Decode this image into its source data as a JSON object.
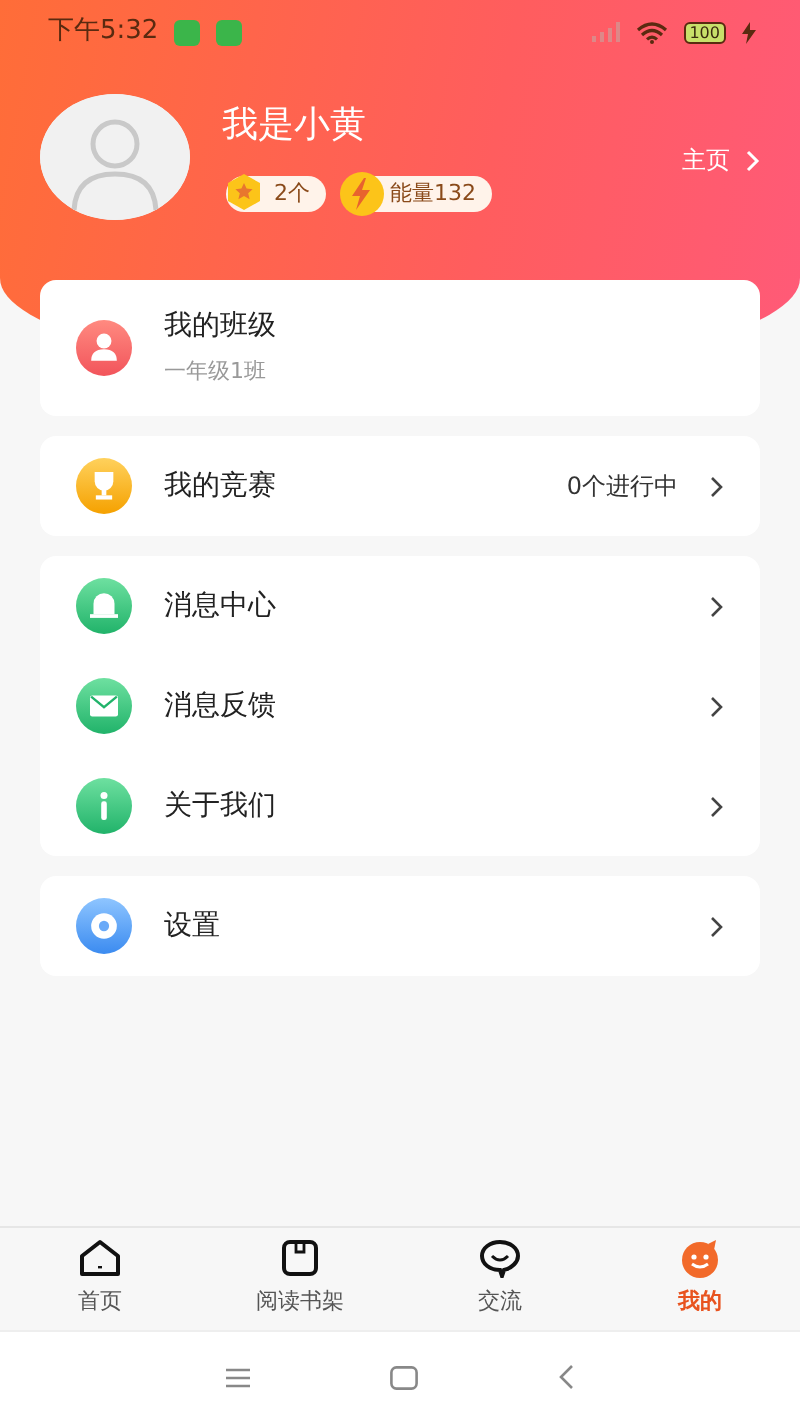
{
  "status_bar": {
    "time": "下午5:32",
    "battery": "100"
  },
  "profile": {
    "name": "我是小黄",
    "homepage_link": "主页",
    "badges": [
      {
        "kind": "medal",
        "text": "2个"
      },
      {
        "kind": "energy",
        "text": "能量132"
      }
    ]
  },
  "menu_groups": [
    {
      "items": [
        {
          "kind": "person",
          "title": "我的班级",
          "subtitle": "一年级1班"
        }
      ]
    },
    {
      "items": [
        {
          "kind": "trophy",
          "title": "我的竞赛",
          "value": "0个进行中"
        }
      ]
    },
    {
      "items": [
        {
          "kind": "bell",
          "title": "消息中心"
        },
        {
          "kind": "mail",
          "title": "消息反馈"
        },
        {
          "kind": "info",
          "title": "关于我们"
        }
      ]
    },
    {
      "items": [
        {
          "kind": "gear",
          "title": "设置"
        }
      ]
    }
  ],
  "tabs": [
    {
      "kind": "home",
      "label": "首页",
      "selected": false
    },
    {
      "kind": "book",
      "label": "阅读书架",
      "selected": false
    },
    {
      "kind": "chat",
      "label": "交流",
      "selected": false
    },
    {
      "kind": "face",
      "label": "我的",
      "selected": true
    }
  ]
}
